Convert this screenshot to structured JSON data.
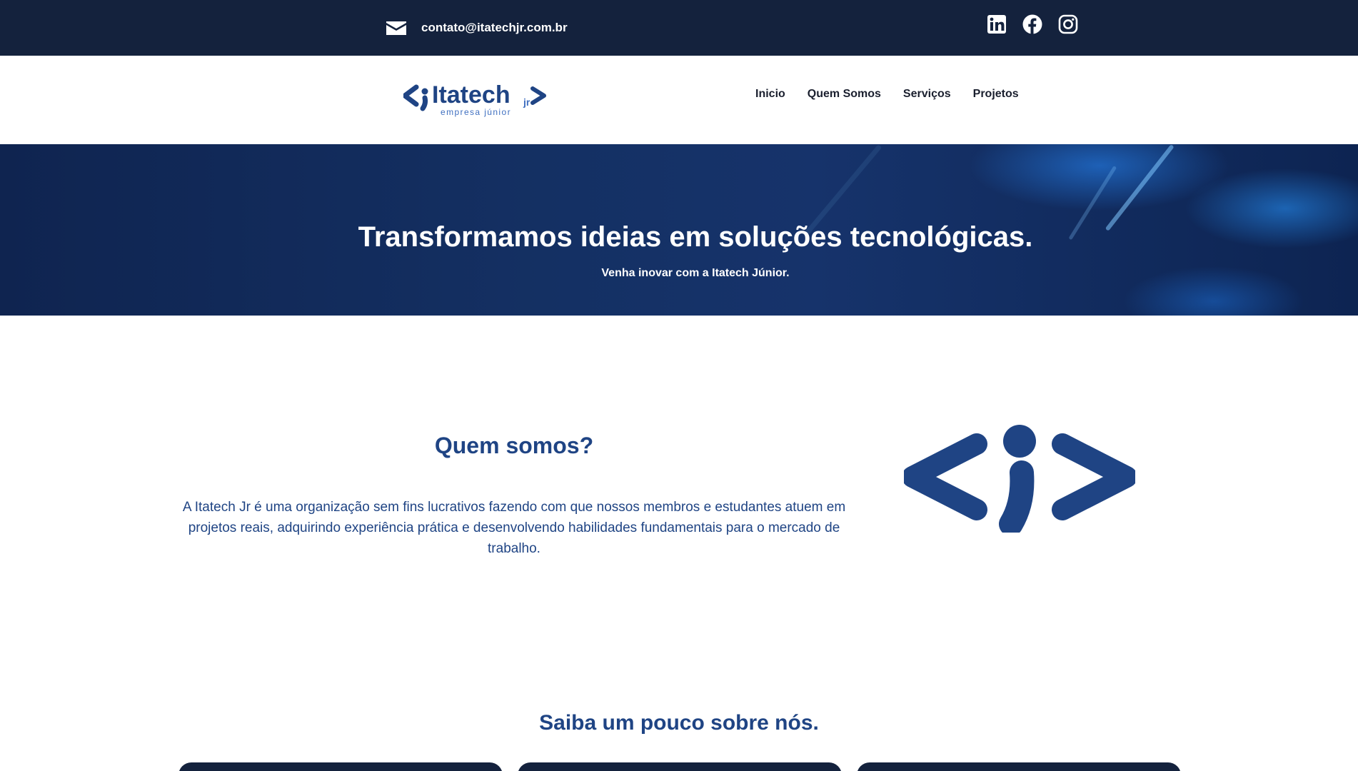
{
  "topbar": {
    "email": "contato@itatechjr.com.br",
    "icons": [
      "envelope-icon",
      "linkedin-icon",
      "facebook-icon",
      "instagram-icon"
    ]
  },
  "header": {
    "logo": {
      "name": "Itatech",
      "suffix": "jr",
      "tagline": "empresa júnior"
    },
    "nav": [
      "Inicio",
      "Quem Somos",
      "Serviços",
      "Projetos"
    ]
  },
  "hero": {
    "title": "Transformamos ideias em soluções tecnológicas.",
    "subtitle": "Venha inovar com a Itatech Júnior."
  },
  "about": {
    "title": "Quem somos?",
    "text": "A Itatech Jr é uma organização sem fins lucrativos fazendo com que nossos membros e estudantes atuem em projetos reais, adquirindo experiência prática e desenvolvendo habilidades fundamentais para o mercado de trabalho."
  },
  "saiba": {
    "title": "Saiba um pouco sobre nós."
  },
  "colors": {
    "topbar": "#14223d",
    "brand": "#1f4484",
    "hero": "#143063"
  }
}
